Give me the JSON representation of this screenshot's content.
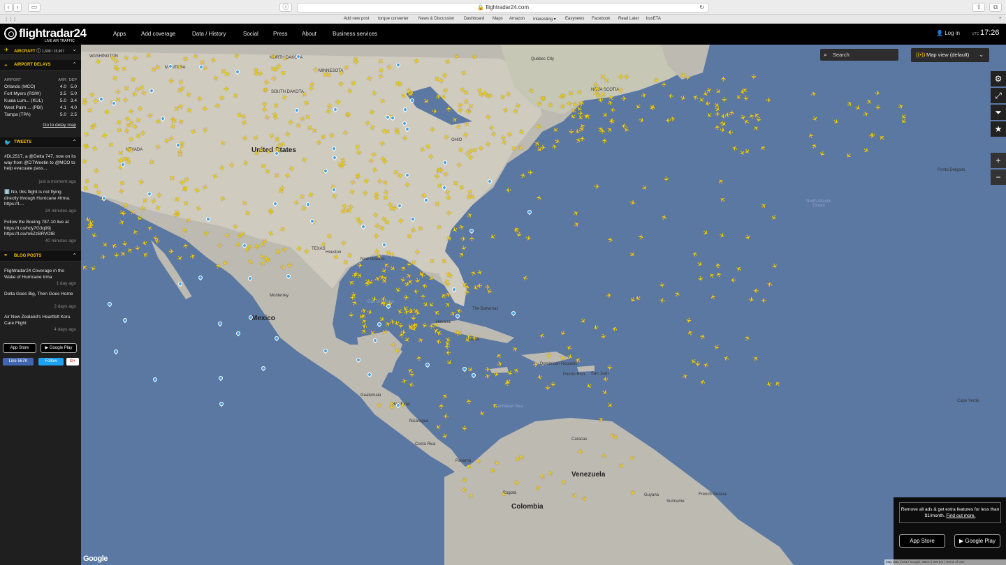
{
  "browser": {
    "url": "flightradar24.com",
    "bookmarks": [
      "Add new post",
      "torque converter",
      "News & Discussion",
      "Dashboard",
      "Maps",
      "Amazon",
      "Interesting ▾",
      "Easynews",
      "Facebook",
      "Read Later",
      "busETA"
    ]
  },
  "header": {
    "logo": "flightradar24",
    "logo_sub": "LIVE AIR TRAFFIC",
    "nav": [
      "Apps",
      "Add coverage",
      "Data / History",
      "Social",
      "Press",
      "About",
      "Business services"
    ],
    "login": "Log in",
    "utc_label": "UTC",
    "time": "17:26"
  },
  "sidebar": {
    "aircraft": {
      "label": "AIRCRAFT",
      "count": "1,500 / 15,907"
    },
    "airport_delays": {
      "label": "AIRPORT DELAYS",
      "columns": [
        "AIRPORT",
        "ARR",
        "DEP"
      ],
      "rows": [
        {
          "airport": "Orlando (MCO)",
          "arr": "4.0",
          "dep": "5.0"
        },
        {
          "airport": "Fort Myers (RSW)",
          "arr": "3.5",
          "dep": "5.0"
        },
        {
          "airport": "Kuala Lum...  (KUL)",
          "arr": "5.0",
          "dep": "3.4"
        },
        {
          "airport": "West Palm ...  (PBI)",
          "arr": "4.1",
          "dep": "4.0"
        },
        {
          "airport": "Tampa (TPA)",
          "arr": "5.0",
          "dep": "2.5"
        }
      ],
      "link": "Go to delay map"
    },
    "tweets": {
      "label": "TWEETS",
      "items": [
        {
          "text": "#DL2517, a @Delta 747, now on its way from @DTWeetin to @MCO to help evacuate pass...",
          "time": "just a moment ago"
        },
        {
          "text": "ℹ️ No, this flight is not flying directly through Hurricane #Irma. https://t....",
          "time": "24 minutes ago"
        },
        {
          "text": "Follow the Boeing 787-10 live at https://t.co/hdy7G3q99j https://t.co/m6ZzBRVOtB",
          "time": "40 minutes ago"
        }
      ]
    },
    "blog": {
      "label": "BLOG POSTS",
      "items": [
        {
          "text": "Flightradar24 Coverage in the Wake of Hurricane Irma",
          "time": "1 day ago"
        },
        {
          "text": "Delta Goes Big, Then Goes Home",
          "time": "2 days ago"
        },
        {
          "text": "Air New Zealand's Heartfelt Koru Care Flight",
          "time": "4 days ago"
        }
      ]
    },
    "app_store": "App Store",
    "app_store_pre": "Download on the",
    "google_play": "Google Play",
    "google_play_pre": "ANDROID APP ON",
    "like": "Like 567K",
    "follow": "Follow",
    "gplus": "G+"
  },
  "map": {
    "search_placeholder": "Search",
    "map_view": "Map view (default)",
    "labels": {
      "united_states": "United States",
      "mexico": "Mexico",
      "venezuela": "Venezuela",
      "colombia": "Colombia",
      "gulf": "Gulf of Mexico",
      "north_atlantic": "North Atlantic Ocean",
      "caribbean": "Caribbean Sea",
      "bahamas": "The Bahamas",
      "cuba": "Cuba",
      "dominican": "Dominican Republic",
      "puerto_rico": "Puerto Rico",
      "nicaragua": "Nicaragua",
      "honduras": "Honduras",
      "guatemala": "Guatemala",
      "panama": "Panama",
      "costa_rica": "Costa Rica",
      "guyana": "Guyana",
      "suriname": "Suriname",
      "french_guiana": "French Guiana",
      "washington": "WASHINGTON",
      "montana": "MONTANA",
      "north_dakota": "NORTH DAKOTA",
      "minnesota": "MINNESOTA",
      "south_dakota": "SOUTH DAKOTA",
      "nevada": "NEVADA",
      "texas": "TEXAS",
      "ohio": "OHIO",
      "quebec": "Québec City",
      "nova_scotia": "NOVA SCOTIA",
      "havana": "Havana",
      "monterrey": "Monterrey",
      "houston": "Houston",
      "new_orleans": "New Orleans",
      "san_juan": "San Juan",
      "caracas": "Caracas",
      "bogota": "Bogotá",
      "ponta_delgada": "Ponta Delgada",
      "cape_verde": "Cape Verde"
    },
    "promo": {
      "text": "Remove all ads & get extra features for less than $1/month.",
      "link": "Find out more."
    },
    "attribution": "Map data ©2017 Google, INEGI  |  200 km  |  Terms of Use",
    "google": "Google"
  }
}
